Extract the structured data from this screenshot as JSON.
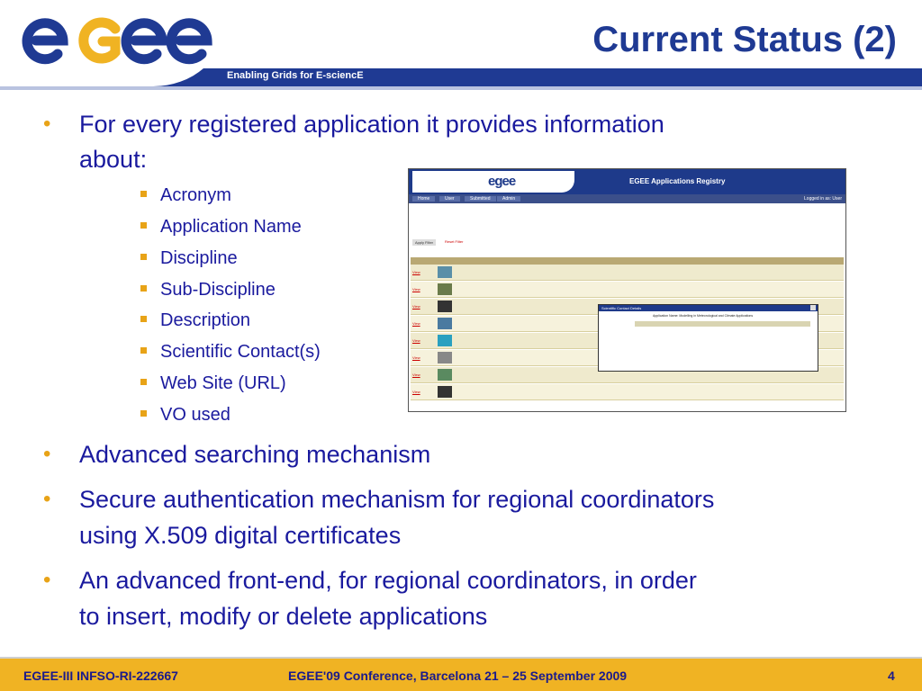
{
  "header": {
    "logo_text": "egee",
    "tagline": "Enabling Grids for E-sciencE",
    "title": "Current Status (2)"
  },
  "bullets": {
    "intro_line1": "For every registered application it provides information",
    "intro_line2": "about:",
    "sub_items": [
      "Acronym",
      "Application Name",
      "Discipline",
      "Sub-Discipline",
      "Description",
      "Scientific Contact(s)",
      "Web Site (URL)",
      "VO used"
    ],
    "point2": "Advanced searching mechanism",
    "point3_line1": "Secure authentication mechanism for regional coordinators",
    "point3_line2": "using X.509 digital certificates",
    "point4_line1": "An advanced front-end, for regional coordinators, in order",
    "point4_line2": "to insert, modify or delete applications"
  },
  "screenshot": {
    "logo_text": "egee",
    "title": "EGEE Applications Registry",
    "nav": [
      "Home",
      "User",
      "Submitted",
      "Admin"
    ],
    "logged_in": "Logged in as: User",
    "apply_filter": "Apply Filter",
    "reset_filter": "Reset Filter",
    "popup_title": "Scientific Contact Details",
    "popup_subtitle": "Application Name: Modelling in Meteorological and Climate Applications",
    "view_link": "View"
  },
  "footer": {
    "left": "EGEE-III INFSO-RI-222667",
    "center": "EGEE'09 Conference, Barcelona 21 – 25 September 2009",
    "page": "4"
  },
  "colors": {
    "title_blue": "#1f3a93",
    "text_blue": "#1a1a9e",
    "bullet_orange": "#e8a317",
    "footer_gold": "#f0b323"
  }
}
